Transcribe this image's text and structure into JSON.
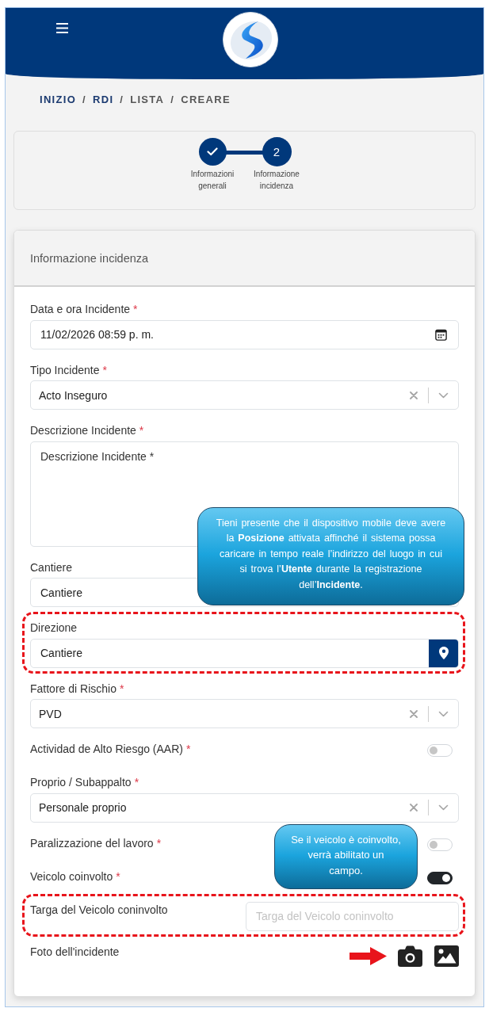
{
  "breadcrumb": [
    {
      "kind": "crumb",
      "label": "INIZIO",
      "link": true
    },
    {
      "kind": "separator",
      "label": "/"
    },
    {
      "kind": "crumb",
      "label": "RDI",
      "link": true
    },
    {
      "kind": "separator",
      "label": "/"
    },
    {
      "kind": "crumb",
      "label": "LISTA",
      "link": false
    },
    {
      "kind": "separator",
      "label": "/"
    },
    {
      "kind": "crumb",
      "label": "CREARE",
      "link": false
    }
  ],
  "stepper": {
    "steps": [
      {
        "label": "Informazioni generali",
        "done": true
      },
      {
        "label": "Informazione incidenza",
        "number": "2",
        "done": false
      }
    ]
  },
  "card": {
    "title": "Informazione incidenza",
    "fields": [
      {
        "kind": "datetime",
        "label": "Data e ora Incidente",
        "required_mark": "*",
        "value": "11/02/2026 08:59 p. m.",
        "highlighted": false
      },
      {
        "kind": "select",
        "label": "Tipo Incidente",
        "required_mark": "*",
        "value": "Acto Inseguro",
        "highlighted": false
      },
      {
        "kind": "textarea",
        "label": "Descrizione Incidente",
        "required_mark": "*",
        "value": "Descrizione Incidente *",
        "highlighted": false
      },
      {
        "kind": "text",
        "label": "Cantiere",
        "value": "Cantiere",
        "highlighted": false,
        "note": "Tieni presente che il dispositivo mobile deve avere la **Posizione** attivata affinché il sistema possa caricare in tempo reale l’indirizzo del luogo in cui si trova l’**Utente** durante la registrazione dell’**Incidente**."
      },
      {
        "kind": "location",
        "label": "Direzione",
        "value": "Cantiere",
        "highlighted": true
      },
      {
        "kind": "select",
        "label": "Fattore di Rischio",
        "required_mark": "*",
        "value": "PVD",
        "highlighted": false
      },
      {
        "kind": "toggle",
        "label": "Actividad de Alto Riesgo (AAR)",
        "required_mark": "*",
        "on": false,
        "highlighted": false
      },
      {
        "kind": "select",
        "label": "Proprio / Subappalto",
        "required_mark": "*",
        "value": "Personale proprio",
        "highlighted": false
      },
      {
        "kind": "toggle",
        "label": "Paralizzazione del lavoro",
        "required_mark": "*",
        "on": false,
        "highlighted": false
      },
      {
        "kind": "toggle",
        "label": "Veicolo coinvolto",
        "required_mark": "*",
        "on": true,
        "highlighted": false,
        "note": "Se il veicolo è coinvolto, verrà abilitato un campo."
      },
      {
        "kind": "inline_text",
        "label": "Targa del Veicolo coninvolto",
        "placeholder": "Targa del Veicolo coninvolto",
        "highlighted": true
      },
      {
        "kind": "photo",
        "label": "Foto dell'incidente",
        "highlighted": false,
        "pointer_arrow": true
      }
    ]
  }
}
